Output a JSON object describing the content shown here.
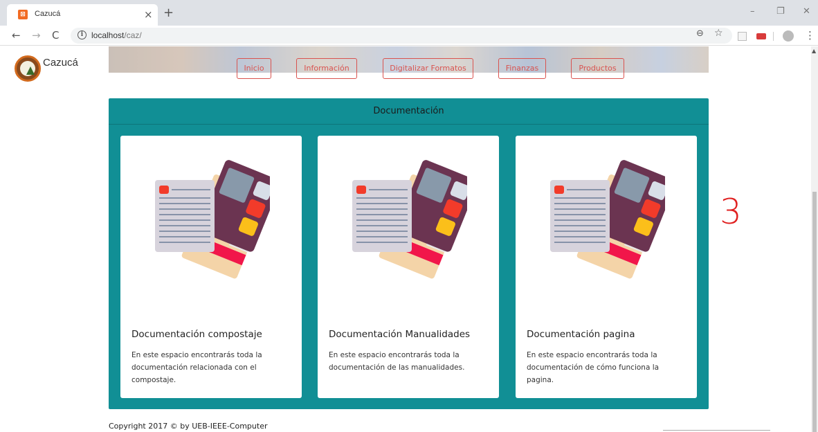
{
  "browser": {
    "tab_title": "Cazucá",
    "tab_close": "×",
    "new_tab": "+",
    "url_host": "localhost",
    "url_path": "/caz/",
    "back": "←",
    "forward": "→",
    "reload": "C",
    "minimize": "–",
    "restore": "❐",
    "close": "✕",
    "zoom": "⊖",
    "bookmark": "☆",
    "menu": "⋮"
  },
  "brand": {
    "name": "Cazucá"
  },
  "nav": {
    "items": [
      "Inicio",
      "Información",
      "Digitalizar Formatos",
      "Finanzas",
      "Productos"
    ]
  },
  "documentation": {
    "heading": "Documentación",
    "cards": [
      {
        "title": "Documentación compostaje",
        "text": "En este espacio encontrarás toda la documentación relacionada con el compostaje."
      },
      {
        "title": "Documentación Manualidades",
        "text": "En este espacio encontrarás toda la documentación de las manualidades."
      },
      {
        "title": "Documentación pagina",
        "text": "En este espacio encontrarás toda la documentación de cómo funciona la pagina."
      }
    ]
  },
  "footer": {
    "copyright": "Copyright 2017 © by UEB-IEEE-Computer"
  },
  "annotation": {
    "text": "3"
  },
  "colors": {
    "panel": "#118f95",
    "nav_accent": "#d9534f",
    "annotation": "#e02020"
  }
}
